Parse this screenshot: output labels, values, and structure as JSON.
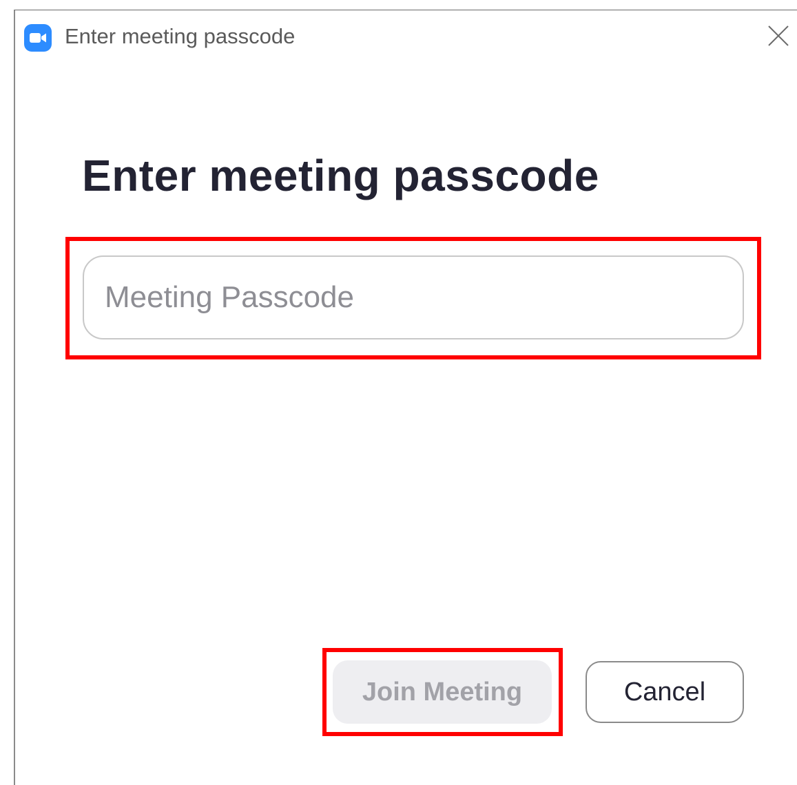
{
  "window": {
    "title": "Enter meeting passcode",
    "app_icon": "zoom-video-camera-icon",
    "close_icon": "close-icon"
  },
  "dialog": {
    "heading": "Enter meeting passcode",
    "passcode_input": {
      "value": "",
      "placeholder": "Meeting Passcode"
    },
    "join_button_label": "Join Meeting",
    "join_button_enabled": false,
    "cancel_button_label": "Cancel"
  },
  "colors": {
    "accent": "#2d8cff",
    "highlight": "#ff0000",
    "heading_text": "#232333",
    "disabled_button_bg": "#eeeef1",
    "disabled_button_text": "#a2a2a8"
  }
}
